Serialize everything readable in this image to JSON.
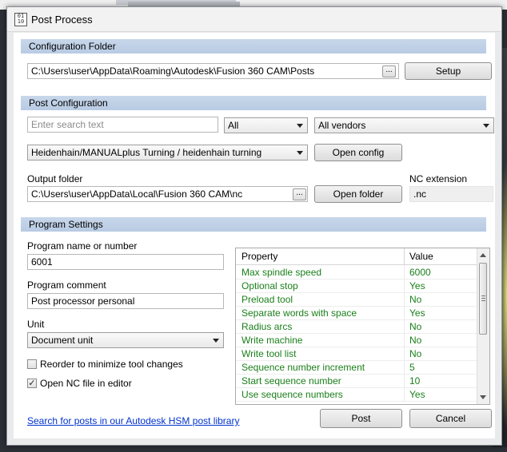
{
  "window": {
    "title": "Post Process",
    "app_icon_text": "01\n10"
  },
  "configuration_folder": {
    "heading": "Configuration Folder",
    "path": "C:\\Users\\user\\AppData\\Roaming\\Autodesk\\Fusion 360 CAM\\Posts",
    "browse_label": "...",
    "setup_label": "Setup"
  },
  "post_configuration": {
    "heading": "Post Configuration",
    "search_placeholder": "Enter search text",
    "filter_selected": "All",
    "vendor_selected": "All vendors",
    "post_selected": "Heidenhain/MANUALplus Turning / heidenhain turning",
    "open_config_label": "Open config",
    "output_folder_label": "Output folder",
    "output_folder_path": "C:\\Users\\user\\AppData\\Local\\Fusion 360 CAM\\nc",
    "output_browse_label": "...",
    "open_folder_label": "Open folder",
    "nc_extension_label": "NC extension",
    "nc_extension_value": ".nc"
  },
  "program_settings": {
    "heading": "Program Settings",
    "program_name_label": "Program name or number",
    "program_name_value": "6001",
    "program_comment_label": "Program comment",
    "program_comment_value": "Post processor personal",
    "unit_label": "Unit",
    "unit_selected": "Document unit",
    "reorder_label": "Reorder to minimize tool changes",
    "reorder_checked": false,
    "open_nc_label": "Open NC file in editor",
    "open_nc_checked": true
  },
  "properties": {
    "header_property": "Property",
    "header_value": "Value",
    "rows": [
      {
        "property": "Max spindle speed",
        "value": "6000"
      },
      {
        "property": "Optional stop",
        "value": "Yes"
      },
      {
        "property": "Preload tool",
        "value": "No"
      },
      {
        "property": "Separate words with space",
        "value": "Yes"
      },
      {
        "property": "Radius arcs",
        "value": "No"
      },
      {
        "property": "Write machine",
        "value": "No"
      },
      {
        "property": "Write tool list",
        "value": "No"
      },
      {
        "property": "Sequence number increment",
        "value": "5"
      },
      {
        "property": "Start sequence number",
        "value": "10"
      },
      {
        "property": "Use sequence numbers",
        "value": "Yes"
      }
    ],
    "row_text_color": "#1a7f1a"
  },
  "footer": {
    "library_link": "Search for posts in our Autodesk HSM post library",
    "post_label": "Post",
    "cancel_label": "Cancel"
  },
  "colors": {
    "section_header": "#c2d3e8",
    "link": "#0033cc"
  }
}
